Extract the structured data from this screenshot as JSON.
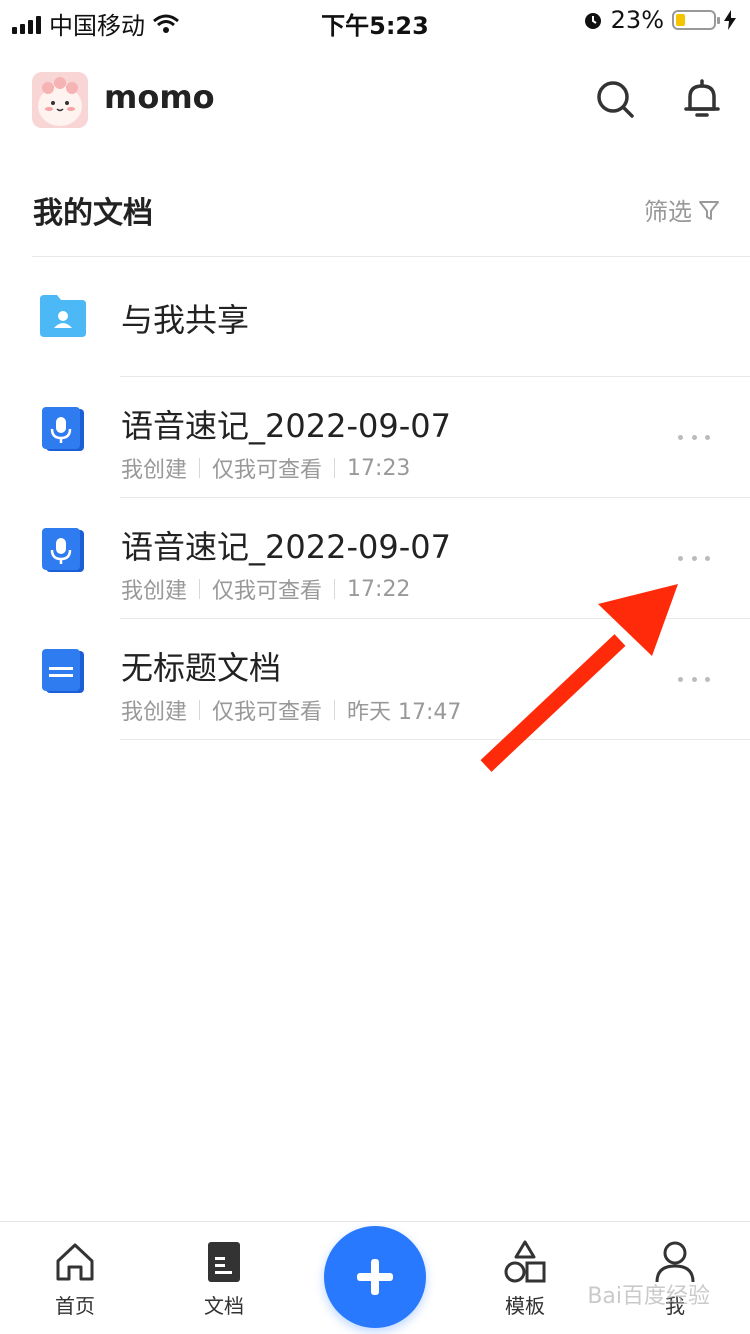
{
  "status_bar": {
    "carrier": "中国移动",
    "time": "下午5:23",
    "battery": "23%"
  },
  "header": {
    "username": "momo"
  },
  "section": {
    "title": "我的文档",
    "filter_label": "筛选"
  },
  "items": [
    {
      "title": "与我共享",
      "icon": "shared-folder-icon"
    },
    {
      "title": "语音速记_2022-09-07",
      "creator": "我创建",
      "permission": "仅我可查看",
      "time": "17:23",
      "icon": "voice-note-icon"
    },
    {
      "title": "语音速记_2022-09-07",
      "creator": "我创建",
      "permission": "仅我可查看",
      "time": "17:22",
      "icon": "voice-note-icon"
    },
    {
      "title": "无标题文档",
      "creator": "我创建",
      "permission": "仅我可查看",
      "time": "昨天 17:47",
      "icon": "document-icon"
    }
  ],
  "tabbar": {
    "home": "首页",
    "docs": "文档",
    "templates": "模板",
    "me": "我"
  },
  "watermark": "Bai百度经验",
  "colors": {
    "accent": "#2979ff",
    "arrow": "#ff2a0a",
    "folder": "#4cb8f5"
  }
}
